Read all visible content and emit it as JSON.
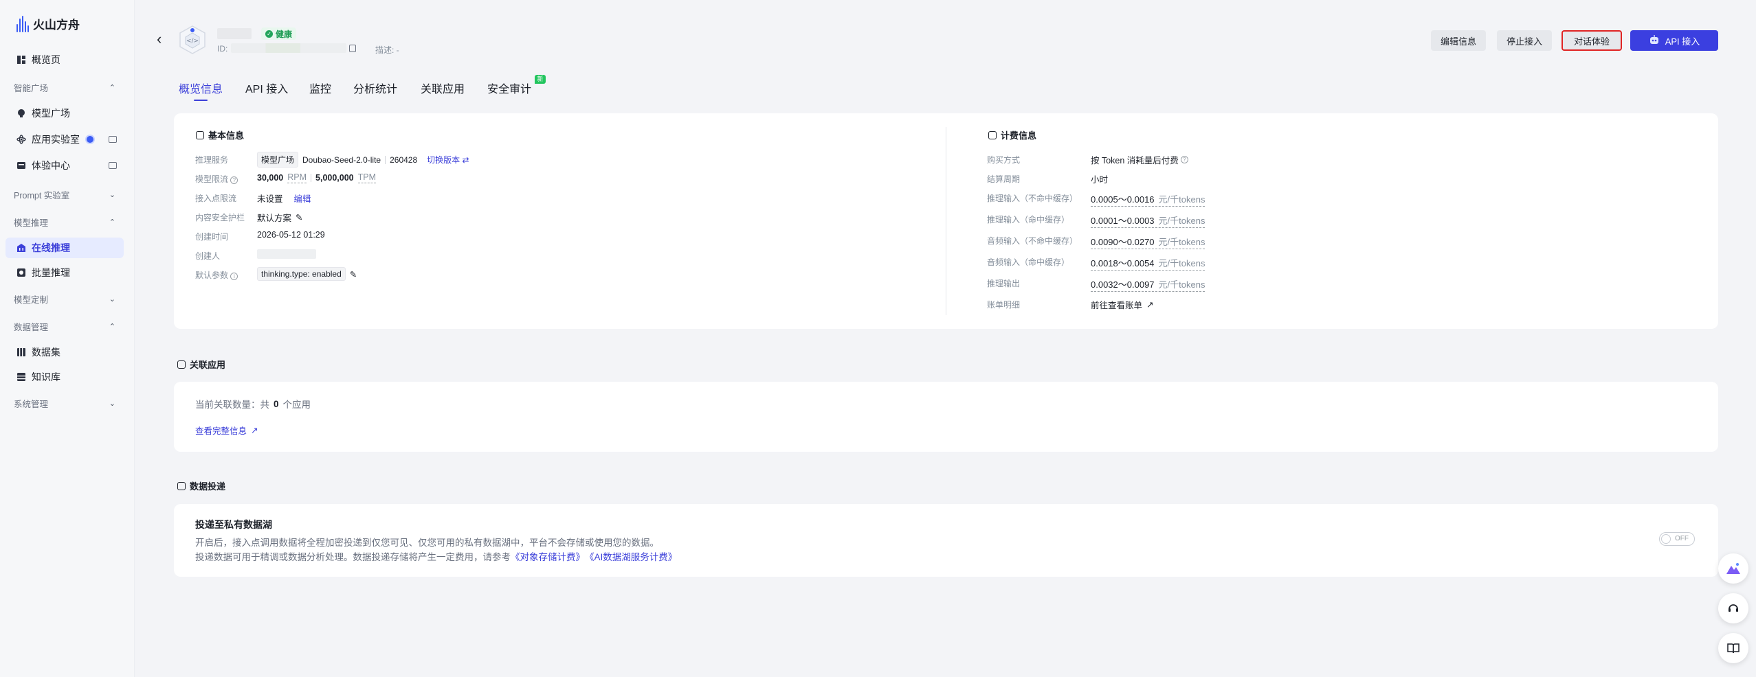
{
  "app": {
    "name": "火山方舟"
  },
  "sidebar": {
    "overview": "概览页",
    "groups": [
      {
        "label": "智能广场",
        "chevron": "⌃"
      },
      {
        "label": "Prompt 实验室",
        "chevron": "⌄"
      },
      {
        "label": "模型推理",
        "chevron": "⌃"
      },
      {
        "label": "模型定制",
        "chevron": "⌄"
      },
      {
        "label": "数据管理",
        "chevron": "⌃"
      },
      {
        "label": "系统管理",
        "chevron": "⌄"
      }
    ],
    "items": {
      "model_square": "模型广场",
      "app_lab": "应用实验室",
      "experience_center": "体验中心",
      "online_inference": "在线推理",
      "batch_inference": "批量推理",
      "datasets": "数据集",
      "knowledge_base": "知识库"
    }
  },
  "header": {
    "status": "健康",
    "id_label": "ID:",
    "desc": "描述: -",
    "buttons": {
      "edit": "编辑信息",
      "stop": "停止接入",
      "chat": "对话体验",
      "api": "API 接入"
    }
  },
  "tabs": [
    "概览信息",
    "API 接入",
    "监控",
    "分析统计",
    "关联应用",
    "安全审计"
  ],
  "tab_new_badge": "新",
  "basic_info": {
    "title": "基本信息",
    "rows": {
      "service_label": "推理服务",
      "service_chip": "模型广场",
      "service_model": "Doubao-Seed-2.0-lite",
      "service_version": "260428",
      "service_switch": "切换版本 ⇄",
      "limit_label": "模型限流",
      "rpm_value": "30,000",
      "rpm_unit": "RPM",
      "tpm_value": "5,000,000",
      "tpm_unit": "TPM",
      "endpoint_limit_label": "接入点限流",
      "endpoint_limit_value": "未设置",
      "endpoint_limit_edit": "编辑",
      "guard_label": "内容安全护栏",
      "guard_value": "默认方案",
      "created_label": "创建时间",
      "created_value": "2026-05-12 01:29",
      "creator_label": "创建人",
      "params_label": "默认参数",
      "params_value": "thinking.type: enabled"
    }
  },
  "billing": {
    "title": "计费信息",
    "rows": [
      {
        "label": "购买方式",
        "value": "按 Token 消耗量后付费",
        "unit": ""
      },
      {
        "label": "结算周期",
        "value": "小时",
        "unit": ""
      },
      {
        "label": "推理输入（不命中缓存）",
        "value": "0.0005～0.0016",
        "unit": "元/千tokens"
      },
      {
        "label": "推理输入（命中缓存）",
        "value": "0.0001～0.0003",
        "unit": "元/千tokens"
      },
      {
        "label": "音频输入（不命中缓存）",
        "value": "0.0090～0.0270",
        "unit": "元/千tokens"
      },
      {
        "label": "音频输入（命中缓存）",
        "value": "0.0018～0.0054",
        "unit": "元/千tokens"
      },
      {
        "label": "推理输出",
        "value": "0.0032～0.0097",
        "unit": "元/千tokens"
      },
      {
        "label": "账单明细",
        "value": "前往查看账单",
        "unit": ""
      }
    ]
  },
  "related_apps": {
    "title": "关联应用",
    "count_prefix": "当前关联数量：共",
    "count": "0",
    "count_suffix": "个应用",
    "link": "查看完整信息"
  },
  "data_delivery": {
    "title": "数据投递",
    "subtitle": "投递至私有数据湖",
    "line1": "开启后，接入点调用数据将全程加密投递到仅您可见、仅您可用的私有数据湖中，平台不会存储或使用您的数据。",
    "line2_prefix": "投递数据可用于精调或数据分析处理。数据投递存储将产生一定费用，请参考",
    "link1": "《对象存储计费》",
    "link2": "《AI数据湖服务计费》",
    "toggle": "OFF"
  },
  "colors": {
    "accent": "#3b3fd9",
    "success": "#22a55b",
    "highlight": "#e02424"
  }
}
